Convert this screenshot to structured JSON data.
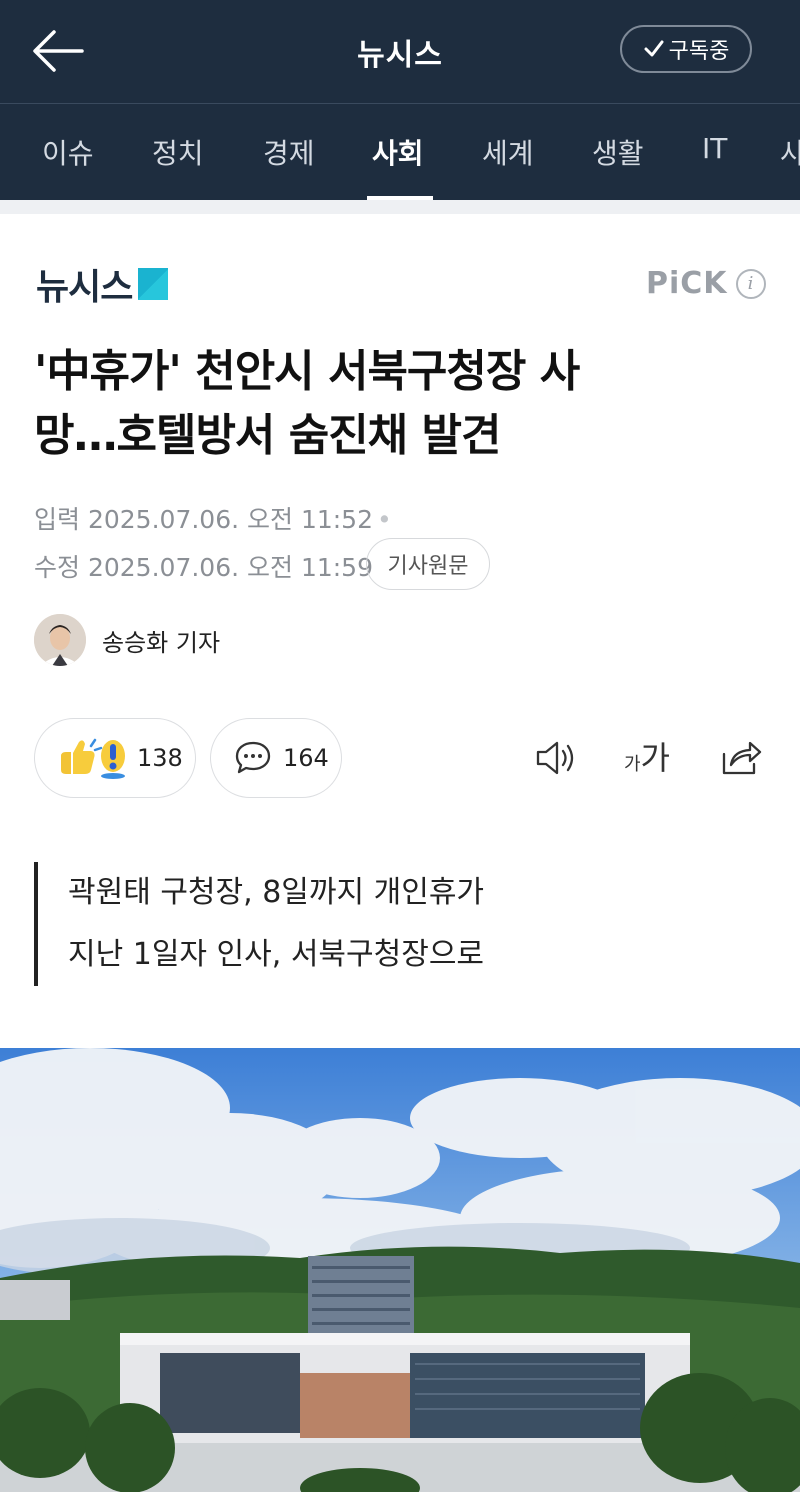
{
  "header": {
    "title": "뉴시스",
    "subscribe_label": "구독중"
  },
  "tabs": [
    {
      "label": "이슈",
      "active": false
    },
    {
      "label": "정치",
      "active": false
    },
    {
      "label": "경제",
      "active": false
    },
    {
      "label": "사회",
      "active": true
    },
    {
      "label": "세계",
      "active": false
    },
    {
      "label": "생활",
      "active": false
    },
    {
      "label": "IT",
      "active": false
    },
    {
      "label": "사",
      "active": false
    }
  ],
  "press": {
    "logo_text": "뉴시스",
    "pick_label": "PiCK",
    "info_label": "i"
  },
  "article": {
    "headline_line1": "'中휴가' 천안시 서북구청장 사",
    "headline_line2": "망…호텔방서 숨진채 발견",
    "input_label": "입력",
    "input_time": "2025.07.06. 오전 11:52",
    "modified_label": "수정",
    "modified_time": "2025.07.06. 오전 11:59",
    "original_button": "기사원문",
    "reporter": "송승화 기자"
  },
  "actions": {
    "reaction_count": "138",
    "comment_count": "164",
    "font_small": "가",
    "font_large": "가"
  },
  "summary": [
    "곽원태 구청장, 8일까지 개인휴가",
    "지난 1일자 인사, 서북구청장으로"
  ],
  "colors": {
    "header_bg": "#1e2d3f",
    "brand_accent": "#1ab3d0",
    "pick_gray": "#9a9fa6"
  },
  "icons": [
    "back-arrow-icon",
    "check-icon",
    "info-icon",
    "reaction-thumb-icon",
    "reaction-exclaim-icon",
    "comment-icon",
    "speaker-icon",
    "font-size-icon",
    "share-icon"
  ]
}
